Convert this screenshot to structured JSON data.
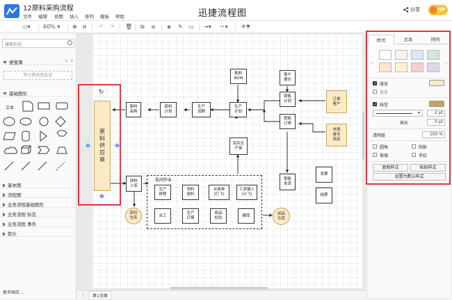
{
  "app": {
    "doc_title": "12原料采购流程",
    "title": "迅捷流程图",
    "share_label": "分享",
    "vip_label": "VIP"
  },
  "menu": [
    "文件",
    "编辑",
    "视图",
    "插入",
    "排列",
    "模板",
    "帮助"
  ],
  "toolbar": {
    "zoom": "60%"
  },
  "left_panel": {
    "search_placeholder": "搜索形状",
    "scratchpad_label": "便笺簿",
    "dropzone_label": "将元素拖到此处",
    "basic_shapes_label": "基础图形",
    "text_shape_label": "文本",
    "more_sections": [
      "基本图",
      "流程图",
      "业务流程基础图形",
      "业务流程 标志",
      "业务流程 事件",
      "箭头"
    ],
    "more_libraries": "更多图库..."
  },
  "page_tab": "第1页面",
  "flow": {
    "supplier": "原料供应商",
    "raw_purchase": "原料\n采购",
    "raw_plan": "原料\n计划",
    "prod_process": "生产\n加期",
    "prod_plan": "生产\n计划",
    "bom": "配料\nBOM",
    "customer_quote": "客户\n报价",
    "sales_plan": "销售\n计划",
    "customer_order": "订单\n客户",
    "sales_order": "销售\n订单",
    "market_forecast": "市场\n或专\n卖店",
    "actual_production": "实际生\n产单",
    "raw_in": "原料\n入库",
    "raw_warehouse": "原料\n仓库",
    "workshop": "车间作业",
    "prod_schedule": "生产\n排程",
    "material_pick": "领料\n退料",
    "dispatch_form": "派单单\n(打飞)",
    "work_input": "工资输入\n(计飞)",
    "work_report": "派工",
    "prod_daily": "生产\n日报",
    "finished_check": "成品\n检验",
    "warehousing": "缴库",
    "finished_warehouse": "成品\n仓库",
    "sales_ship": "销售\n发货",
    "delivery": "发票",
    "settlement": "结算"
  },
  "right_panel": {
    "tabs": [
      "样式",
      "文本",
      "排列"
    ],
    "active_tab": "样式",
    "swatches": [
      "#ffffff",
      "#f5f5f5",
      "#dae8fc",
      "#d5e8d4",
      "#ffe6cc",
      "#fff2cc",
      "#f8cecc",
      "#e1d5e7"
    ],
    "fill_label": "填充",
    "fill_checked": true,
    "fill_color": "#fbeac3",
    "gradient_label": "渐变",
    "gradient_checked": false,
    "line_label": "线型",
    "line_checked": true,
    "line_color": "#c8a35e",
    "line_width": "2 pt",
    "perimeter_label": "周长",
    "perimeter_value": "0 pt",
    "opacity_label": "透明度",
    "opacity_value": "100 %",
    "rounded_label": "圆角",
    "shadow_label": "阴影",
    "glass_label": "玻璃",
    "sketch_label": "手绘",
    "copy_style": "复制样式",
    "paste_style": "粘贴样式",
    "set_default": "设置为默认样式"
  }
}
